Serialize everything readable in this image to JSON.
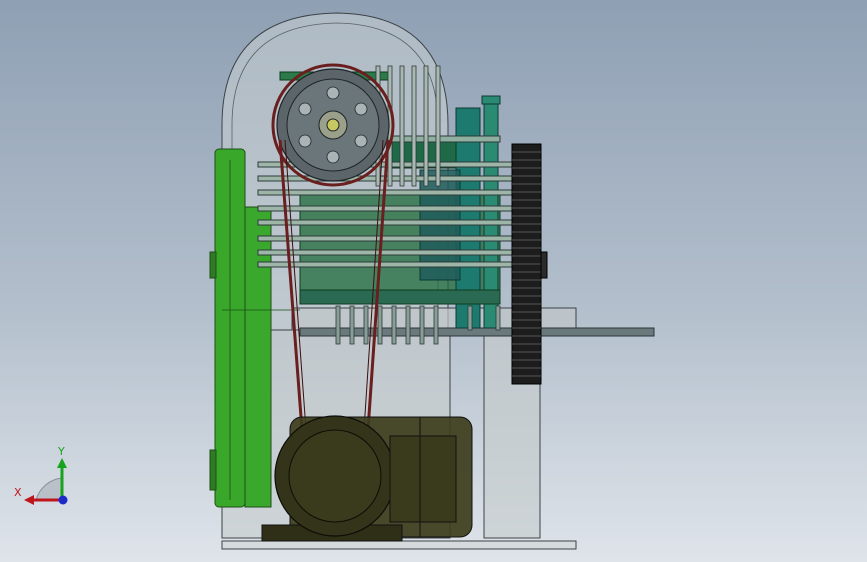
{
  "viewport": {
    "background_top": "#8fa0b4",
    "background_bottom": "#dfe4ea"
  },
  "model": {
    "housing_color": "#c4cbcc",
    "green_part_color": "#39a82a",
    "dark_green_color": "#1f6b3a",
    "teal_color": "#1c7b6e",
    "motor_color": "#3a3a1a",
    "belt_color": "#6a1e1e",
    "gear_color": "#1d1d1d",
    "pulley_color": "#5a6468"
  },
  "triad": {
    "x_label": "X",
    "y_label": "Y",
    "x_color": "#c0161b",
    "y_color": "#17a31d",
    "z_color": "#1d2cc8"
  }
}
